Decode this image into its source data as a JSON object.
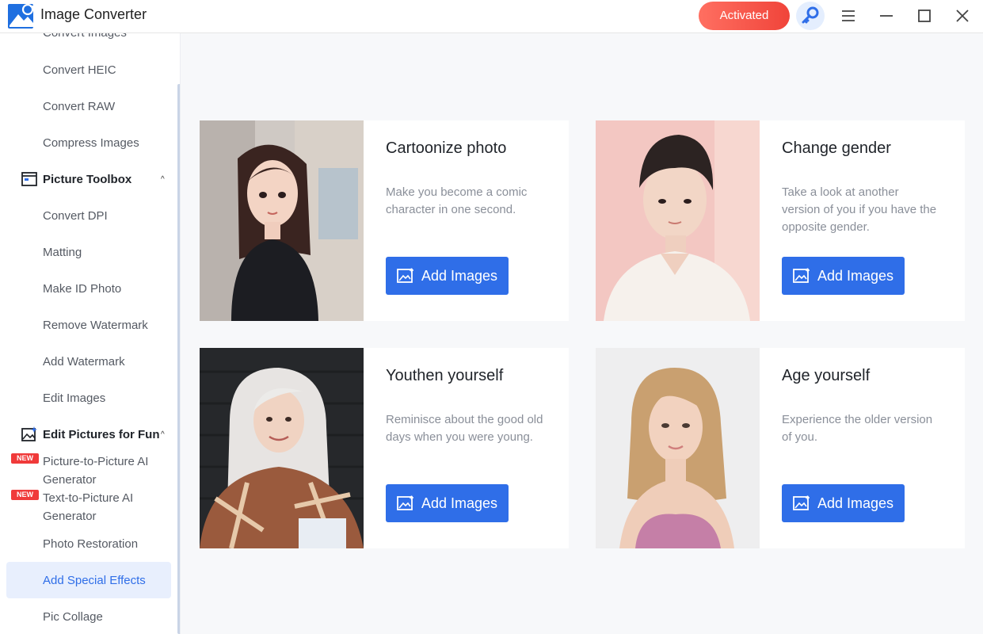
{
  "app": {
    "title": "Image Converter",
    "activated_label": "Activated"
  },
  "sidebar": {
    "cut_item": "Convert Images",
    "items_top": [
      "Convert HEIC",
      "Convert RAW",
      "Compress Images"
    ],
    "group1": {
      "label": "Picture Toolbox",
      "icon": "toolbox-icon"
    },
    "group1_items": [
      "Convert DPI",
      "Matting",
      "Make ID Photo",
      "Remove Watermark",
      "Add Watermark",
      "Edit Images"
    ],
    "group2": {
      "label": "Edit Pictures for Fun",
      "icon": "image-edit-icon"
    },
    "new_badge": "NEW",
    "new_items": [
      "Picture-to-Picture AI Generator",
      "Text-to-Picture AI Generator"
    ],
    "items_bottom": [
      "Photo Restoration",
      "Add Special Effects",
      "Pic Collage"
    ],
    "active_item": "Add Special Effects"
  },
  "cards": [
    {
      "title": "Cartoonize photo",
      "description": "Make you become a comic character in one second.",
      "button": "Add Images"
    },
    {
      "title": "Change gender",
      "description": "Take a look at another version of you if you have the opposite gender.",
      "button": "Add Images"
    },
    {
      "title": "Youthen yourself",
      "description": "Reminisce about the good old days when you were young.",
      "button": "Add Images"
    },
    {
      "title": "Age yourself",
      "description": "Experience the older version of you.",
      "button": "Add Images"
    }
  ],
  "colors": {
    "accent": "#2f6ee8",
    "activated": "#f0443a",
    "active_bg": "#e8effd",
    "new_badge": "#f03a3a"
  }
}
